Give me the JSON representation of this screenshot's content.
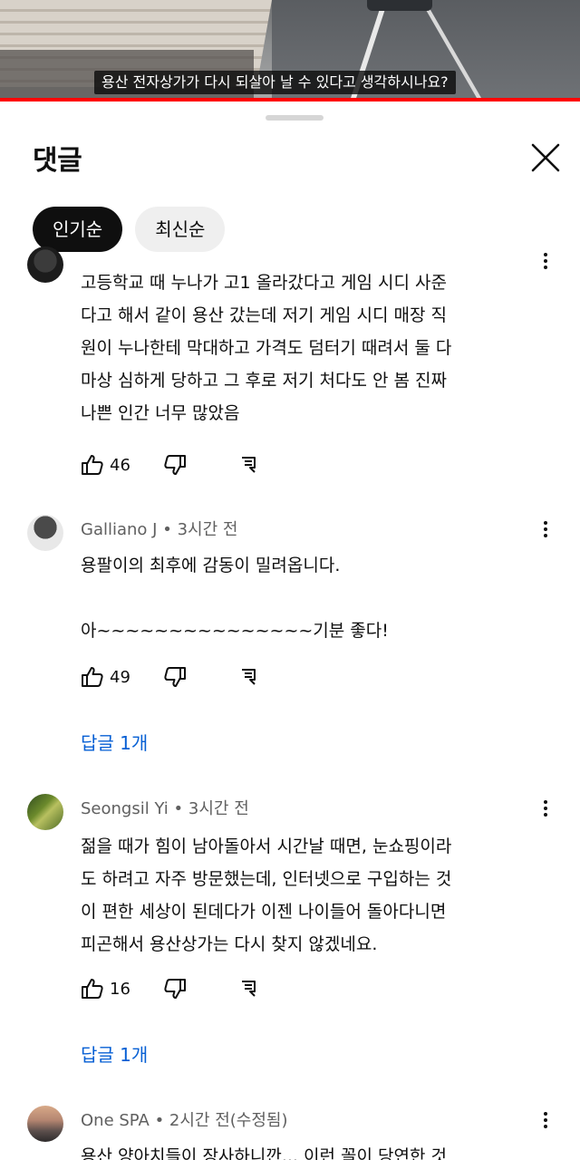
{
  "video": {
    "caption": "용산 전자상가가 다시 되살아 날 수 있다고 생각하시나요?"
  },
  "panel": {
    "title": "댓글",
    "sort_options": [
      {
        "label": "인기순",
        "selected": true
      },
      {
        "label": "최신순",
        "selected": false
      }
    ]
  },
  "comments": [
    {
      "author": "",
      "time": "",
      "lines": [
        "고등학교 때 누나가 고1 올라갔다고 게임 시디 사준",
        "다고 해서 같이 용산 갔는데 저기 게임 시디 매장 직",
        "원이 누나한테 막대하고 가격도 덤터기 때려서 둘 다",
        "마상 심하게 당하고 그 후로 저기 처다도 안 봄 진짜",
        "나쁜 인간 너무 많았음"
      ],
      "likes": "46",
      "replies": ""
    },
    {
      "author": "Galliano J",
      "time": "3시간 전",
      "lines": [
        "용팔이의 최후에 감동이 밀려옵니다.",
        "",
        "아~~~~~~~~~~~~~~~기분 좋다!"
      ],
      "likes": "49",
      "replies": "답글 1개"
    },
    {
      "author": "Seongsil Yi",
      "time": "3시간 전",
      "lines": [
        "젊을 때가 힘이 남아돌아서 시간날 때면, 눈쇼핑이라",
        "도 하려고 자주 방문했는데, 인터넷으로 구입하는 것",
        "이 편한 세상이 된데다가 이젠 나이들어 돌아다니면",
        "피곤해서 용산상가는 다시 찾지 않겠네요."
      ],
      "likes": "16",
      "replies": "답글 1개"
    },
    {
      "author": "One SPA",
      "time": "2시간 전(수정됨)",
      "lines": [
        "용산 양아치들이 장사하니깐... 이런 꼴이 당연한 것"
      ],
      "likes": "",
      "replies": ""
    }
  ],
  "meta_separator": "•",
  "colors": {
    "progress": "#ff0000",
    "reply_link": "#065fd4",
    "chip_active_bg": "#0f0f0f",
    "chip_bg": "#efefef"
  },
  "video_progress": 1.0
}
